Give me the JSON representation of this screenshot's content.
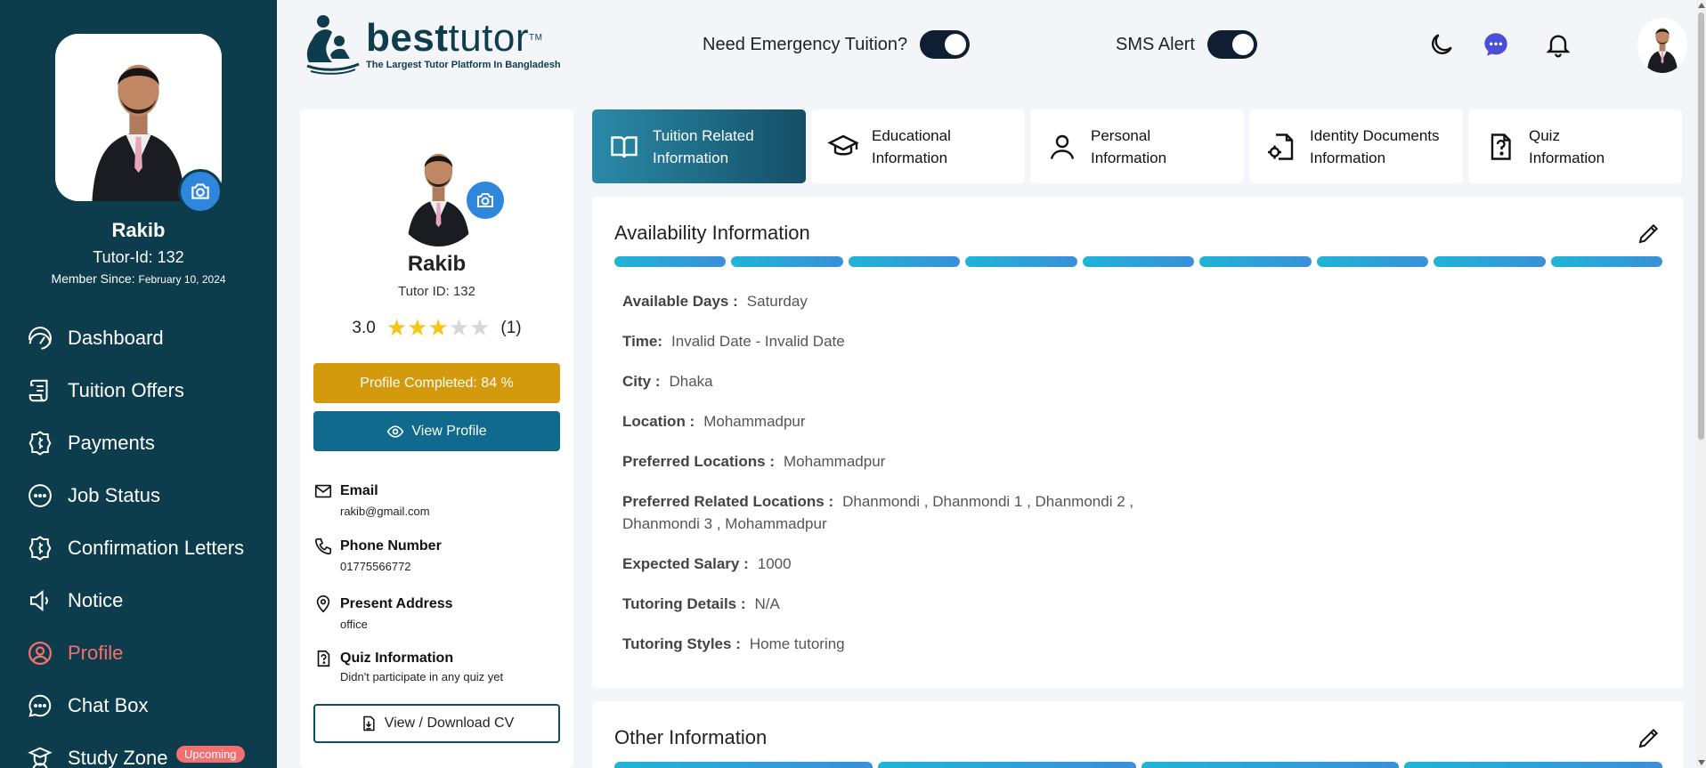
{
  "sidebar": {
    "name": "Rakib",
    "tutor_id": "Tutor-Id: 132",
    "member_label": "Member Since:",
    "member_date": "February 10, 2024",
    "items": [
      {
        "label": "Dashboard",
        "icon": "gauge-icon"
      },
      {
        "label": "Tuition Offers",
        "icon": "scroll-icon"
      },
      {
        "label": "Payments",
        "icon": "coin-icon"
      },
      {
        "label": "Job Status",
        "icon": "dots-circle-icon"
      },
      {
        "label": "Confirmation Letters",
        "icon": "coin-icon"
      },
      {
        "label": "Notice",
        "icon": "speaker-icon"
      },
      {
        "label": "Profile",
        "icon": "user-circle-icon",
        "active": true
      },
      {
        "label": "Chat Box",
        "icon": "chat-bubble-icon"
      },
      {
        "label": "Study Zone",
        "icon": "graduate-icon",
        "badge": "Upcoming"
      }
    ]
  },
  "header": {
    "logo_bold": "best",
    "logo_light": "tutor",
    "logo_tm": "TM",
    "logo_tagline": "The Largest Tutor Platform In Bangladesh",
    "emergency_label": "Need Emergency Tuition?",
    "sms_label": "SMS Alert",
    "icons": [
      "moon-icon",
      "messenger-icon",
      "bell-icon",
      "avatar"
    ]
  },
  "profile_card": {
    "name": "Rakib",
    "tutor_id": "Tutor ID: 132",
    "rating": "3.0",
    "rating_value": 3,
    "rating_max": 5,
    "rating_count": "(1)",
    "completed": "Profile Completed: 84 %",
    "view_profile": "View Profile",
    "email_label": "Email",
    "email": "rakib@gmail.com",
    "phone_label": "Phone Number",
    "phone": "01775566772",
    "address_label": "Present Address",
    "address": "office",
    "quiz_label": "Quiz Information",
    "quiz": "Didn't participate in any quiz yet",
    "cv_button": "View / Download CV"
  },
  "tabs": [
    {
      "line1": "Tuition Related",
      "line2": "Information",
      "active": true
    },
    {
      "line1": "Educational",
      "line2": "Information"
    },
    {
      "line1": "Personal",
      "line2": "Information"
    },
    {
      "line1": "Identity Documents",
      "line2": "Information"
    },
    {
      "line1": "Quiz",
      "line2": "Information"
    }
  ],
  "availability": {
    "title": "Availability Information",
    "progress_segments_filled": 9,
    "progress_segments_total": 9,
    "rows": [
      {
        "key": "Available Days :",
        "value": "Saturday"
      },
      {
        "key": "Time:",
        "value": "Invalid Date - Invalid Date"
      },
      {
        "key": "City :",
        "value": "Dhaka"
      },
      {
        "key": "Location :",
        "value": "Mohammadpur"
      },
      {
        "key": "Preferred Locations :",
        "value": "Mohammadpur"
      },
      {
        "key": "Preferred Related Locations :",
        "value": "Dhanmondi , Dhanmondi 1 , Dhanmondi 2 , Dhanmondi 3 , Mohammadpur"
      },
      {
        "key": "Expected Salary :",
        "value": "1000"
      },
      {
        "key": "Tutoring Details :",
        "value": "N/A"
      },
      {
        "key": "Tutoring Styles :",
        "value": "Home tutoring"
      }
    ]
  },
  "other": {
    "title": "Other Information",
    "progress_segments_total": 4
  },
  "colors": {
    "sidebar_bg": "#0d3d4d",
    "active_nav": "#f46f6f",
    "completed_btn": "#d49a0d",
    "view_btn": "#0f6a8e",
    "progress": "#21b4d6",
    "star": "#f5c518"
  }
}
